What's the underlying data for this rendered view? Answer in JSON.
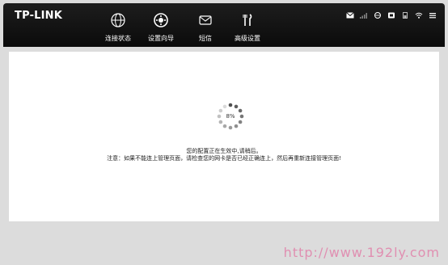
{
  "header": {
    "logo": "TP-LINK",
    "nav": [
      {
        "label": "连接状态",
        "icon": "globe-icon"
      },
      {
        "label": "设置向导",
        "icon": "gear-icon"
      },
      {
        "label": "短信",
        "icon": "mail-icon"
      },
      {
        "label": "高级设置",
        "icon": "tools-icon"
      }
    ],
    "status_icons": [
      "mail-status-icon",
      "signal-icon",
      "globe-status-icon",
      "sd-card-icon",
      "battery-icon",
      "wifi-icon",
      "menu-icon"
    ]
  },
  "main": {
    "progress_label": "8%",
    "progress_percent": 8,
    "message_line1": "您的配置正在生效中,请稍后。",
    "message_line2": "注意：如果不能连上管理页面，请检查您的网卡是否已经正确连上，然后再重新连接管理页面!"
  },
  "watermark": "http://www.192ly.com",
  "colors": {
    "topbar": "#111111",
    "content_bg": "#ffffff",
    "page_bg": "#dcdcdc",
    "watermark": "#e08fb1"
  }
}
